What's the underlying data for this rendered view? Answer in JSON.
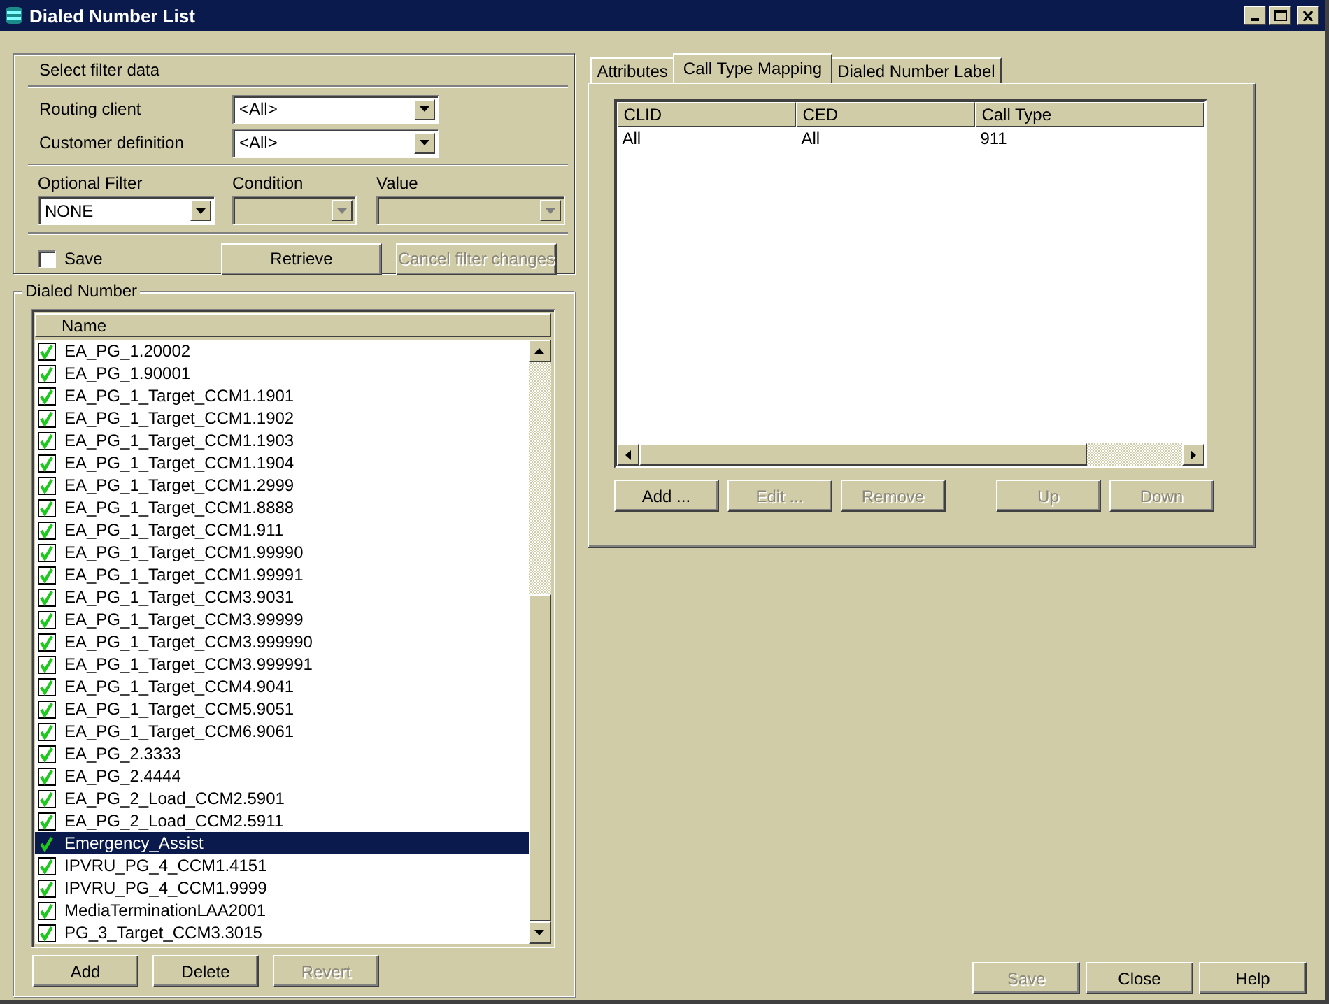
{
  "window": {
    "title": "Dialed Number List"
  },
  "filter": {
    "heading": "Select filter data",
    "fields": [
      {
        "label": "Routing client",
        "value": "<All>"
      },
      {
        "label": "Customer definition",
        "value": "<All>"
      }
    ],
    "optional": [
      {
        "label": "Optional Filter",
        "value": "NONE",
        "disabled": false
      },
      {
        "label": "Condition",
        "disabled": true
      },
      {
        "label": "Value",
        "disabled": true
      }
    ],
    "save": {
      "label": "Save",
      "checked": false
    },
    "buttons": [
      {
        "label": "Retrieve",
        "disabled": false
      },
      {
        "label": "Cancel filter changes",
        "disabled": true
      }
    ]
  },
  "dialed_number": {
    "legend": "Dialed Number",
    "column": "Name",
    "rows": [
      {
        "name": "EA_PG_1.20002",
        "checked": true,
        "selected": false
      },
      {
        "name": "EA_PG_1.90001",
        "checked": true,
        "selected": false
      },
      {
        "name": "EA_PG_1_Target_CCM1.1901",
        "checked": true,
        "selected": false
      },
      {
        "name": "EA_PG_1_Target_CCM1.1902",
        "checked": true,
        "selected": false
      },
      {
        "name": "EA_PG_1_Target_CCM1.1903",
        "checked": true,
        "selected": false
      },
      {
        "name": "EA_PG_1_Target_CCM1.1904",
        "checked": true,
        "selected": false
      },
      {
        "name": "EA_PG_1_Target_CCM1.2999",
        "checked": true,
        "selected": false
      },
      {
        "name": "EA_PG_1_Target_CCM1.8888",
        "checked": true,
        "selected": false
      },
      {
        "name": "EA_PG_1_Target_CCM1.911",
        "checked": true,
        "selected": false
      },
      {
        "name": "EA_PG_1_Target_CCM1.99990",
        "checked": true,
        "selected": false
      },
      {
        "name": "EA_PG_1_Target_CCM1.99991",
        "checked": true,
        "selected": false
      },
      {
        "name": "EA_PG_1_Target_CCM3.9031",
        "checked": true,
        "selected": false
      },
      {
        "name": "EA_PG_1_Target_CCM3.99999",
        "checked": true,
        "selected": false
      },
      {
        "name": "EA_PG_1_Target_CCM3.999990",
        "checked": true,
        "selected": false
      },
      {
        "name": "EA_PG_1_Target_CCM3.999991",
        "checked": true,
        "selected": false
      },
      {
        "name": "EA_PG_1_Target_CCM4.9041",
        "checked": true,
        "selected": false
      },
      {
        "name": "EA_PG_1_Target_CCM5.9051",
        "checked": true,
        "selected": false
      },
      {
        "name": "EA_PG_1_Target_CCM6.9061",
        "checked": true,
        "selected": false
      },
      {
        "name": "EA_PG_2.3333",
        "checked": true,
        "selected": false
      },
      {
        "name": "EA_PG_2.4444",
        "checked": true,
        "selected": false
      },
      {
        "name": "EA_PG_2_Load_CCM2.5901",
        "checked": true,
        "selected": false
      },
      {
        "name": "EA_PG_2_Load_CCM2.5911",
        "checked": true,
        "selected": false
      },
      {
        "name": "Emergency_Assist",
        "checked": true,
        "selected": true
      },
      {
        "name": "IPVRU_PG_4_CCM1.4151",
        "checked": true,
        "selected": false
      },
      {
        "name": "IPVRU_PG_4_CCM1.9999",
        "checked": true,
        "selected": false
      },
      {
        "name": "MediaTerminationLAA2001",
        "checked": true,
        "selected": false
      },
      {
        "name": "PG_3_Target_CCM3.3015",
        "checked": true,
        "selected": false
      }
    ],
    "buttons": [
      {
        "label": "Add",
        "disabled": false
      },
      {
        "label": "Delete",
        "disabled": false
      },
      {
        "label": "Revert",
        "disabled": true
      }
    ]
  },
  "tabs": [
    {
      "label": "Attributes",
      "selected": false
    },
    {
      "label": "Call Type Mapping",
      "selected": true
    },
    {
      "label": "Dialed Number Label",
      "selected": false
    }
  ],
  "mapping": {
    "columns": [
      "CLID",
      "CED",
      "Call Type"
    ],
    "rows": [
      [
        "All",
        "All",
        "911"
      ]
    ],
    "buttons": [
      {
        "label": "Add ...",
        "disabled": false
      },
      {
        "label": "Edit ...",
        "disabled": true
      },
      {
        "label": "Remove",
        "disabled": true
      },
      {
        "label": "Up",
        "disabled": true
      },
      {
        "label": "Down",
        "disabled": true
      }
    ]
  },
  "footer_buttons": [
    {
      "label": "Save",
      "disabled": true
    },
    {
      "label": "Close",
      "disabled": false
    },
    {
      "label": "Help",
      "disabled": false
    }
  ]
}
